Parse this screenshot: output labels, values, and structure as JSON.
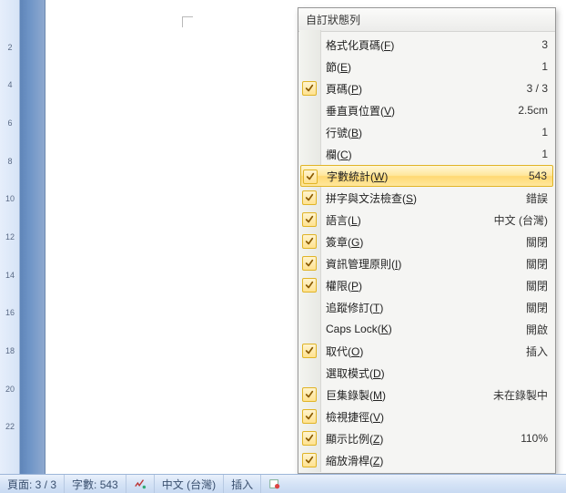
{
  "ruler": {
    "numbers": [
      2,
      4,
      6,
      8,
      10,
      12,
      14,
      16,
      18,
      20,
      22
    ]
  },
  "statusbar": {
    "page": "頁面: 3 / 3",
    "wordcount": "字數: 543",
    "language": "中文 (台灣)",
    "mode": "插入"
  },
  "menu": {
    "title": "自訂狀態列",
    "items": [
      {
        "checked": false,
        "label": "格式化頁碼",
        "hotkey": "F",
        "value": "3"
      },
      {
        "checked": false,
        "label": "節",
        "hotkey": "E",
        "value": "1"
      },
      {
        "checked": true,
        "label": "頁碼",
        "hotkey": "P",
        "value": "3 / 3"
      },
      {
        "checked": false,
        "label": "垂直頁位置",
        "hotkey": "V",
        "value": "2.5cm"
      },
      {
        "checked": false,
        "label": "行號",
        "hotkey": "B",
        "value": "1"
      },
      {
        "checked": false,
        "label": "欄",
        "hotkey": "C",
        "value": "1"
      },
      {
        "checked": true,
        "label": "字數統計",
        "hotkey": "W",
        "value": "543",
        "highlight": true
      },
      {
        "checked": true,
        "label": "拼字與文法檢查",
        "hotkey": "S",
        "value": "錯誤"
      },
      {
        "checked": true,
        "label": "語言",
        "hotkey": "L",
        "value": "中文 (台灣)"
      },
      {
        "checked": true,
        "label": "簽章",
        "hotkey": "G",
        "value": "關閉"
      },
      {
        "checked": true,
        "label": "資訊管理原則",
        "hotkey": "I",
        "value": "關閉"
      },
      {
        "checked": true,
        "label": "權限",
        "hotkey": "P",
        "value": "關閉"
      },
      {
        "checked": false,
        "label": "追蹤修訂",
        "hotkey": "T",
        "value": "關閉"
      },
      {
        "checked": false,
        "label": "Caps Lock",
        "hotkey": "K",
        "value": "開啟"
      },
      {
        "checked": true,
        "label": "取代",
        "hotkey": "O",
        "value": "插入"
      },
      {
        "checked": false,
        "label": "選取模式",
        "hotkey": "D",
        "value": ""
      },
      {
        "checked": true,
        "label": "巨集錄製",
        "hotkey": "M",
        "value": "未在錄製中"
      },
      {
        "checked": true,
        "label": "檢視捷徑",
        "hotkey": "V",
        "value": ""
      },
      {
        "checked": true,
        "label": "顯示比例",
        "hotkey": "Z",
        "value": "110%"
      },
      {
        "checked": true,
        "label": "縮放滑桿",
        "hotkey": "Z",
        "value": ""
      }
    ]
  }
}
